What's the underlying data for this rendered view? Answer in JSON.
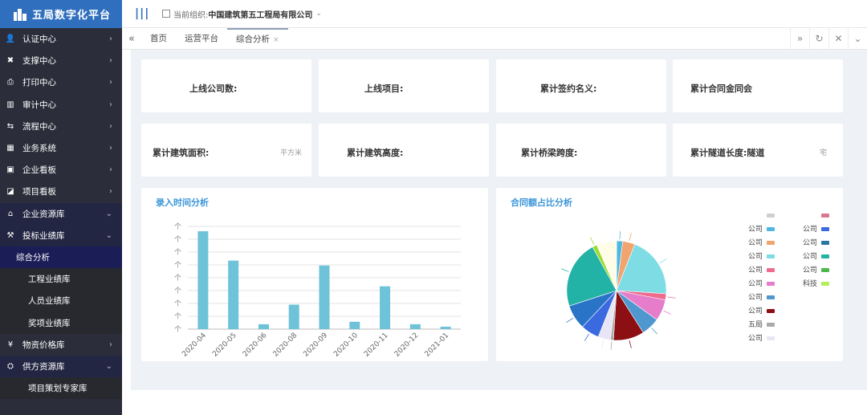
{
  "brand": {
    "title": "五局数字化平台"
  },
  "topbar": {
    "org_label": "当前组织:",
    "org_name": "中国建筑第五工程局有限公司"
  },
  "menu": [
    {
      "label": "认证中心",
      "icon": "user-icon",
      "arrow": "›"
    },
    {
      "label": "支撑中心",
      "icon": "tools-icon",
      "arrow": "›"
    },
    {
      "label": "打印中心",
      "icon": "printer-icon",
      "arrow": "›"
    },
    {
      "label": "审计中心",
      "icon": "bar-chart-icon",
      "arrow": "›"
    },
    {
      "label": "流程中心",
      "icon": "flow-icon",
      "arrow": "›"
    },
    {
      "label": "业务系统",
      "icon": "grid-icon",
      "arrow": "›"
    },
    {
      "label": "企业看板",
      "icon": "board-icon",
      "arrow": "›"
    },
    {
      "label": "项目看板",
      "icon": "project-icon",
      "arrow": "›"
    },
    {
      "label": "企业资源库",
      "icon": "bank-icon",
      "arrow": "⌄"
    },
    {
      "label": "投标业绩库",
      "icon": "gavel-icon",
      "arrow": "⌄"
    },
    {
      "label": "综合分析"
    },
    {
      "label": "工程业绩库"
    },
    {
      "label": "人员业绩库"
    },
    {
      "label": "奖项业绩库"
    },
    {
      "label": "物资价格库",
      "icon": "price-icon",
      "arrow": "›"
    },
    {
      "label": "供方资源库",
      "icon": "supplier-icon",
      "arrow": "⌄"
    },
    {
      "label": "项目策划专家库"
    }
  ],
  "tabs": [
    {
      "label": "首页"
    },
    {
      "label": "运营平台"
    },
    {
      "label": "综合分析",
      "close": "×"
    }
  ],
  "stats_row1": [
    {
      "label": "上线公司数:"
    },
    {
      "label": "上线项目:"
    },
    {
      "label": "累计签约名义:"
    },
    {
      "label": "累计合同金同会"
    }
  ],
  "stats_row2": [
    {
      "label": "累计建筑面积:",
      "unit": "平方米"
    },
    {
      "label": "累计建筑高度:"
    },
    {
      "label": "累计桥梁跨度:"
    },
    {
      "label": "累计隧道长度:隧道",
      "unit": "宅"
    }
  ],
  "bar_panel": {
    "title": "录入时间分析"
  },
  "pie_panel": {
    "title": "合同额占比分析"
  },
  "colors": {
    "accent": "#3a95d9",
    "bar": "#6ec3d8",
    "brand": "#2f6fbd"
  },
  "chart_data": [
    {
      "type": "bar",
      "title": "录入时间分析",
      "categories": [
        "2020-04",
        "2020-05",
        "2020-06",
        "2020-08",
        "2020-09",
        "2020-10",
        "2020-11",
        "2020-12",
        "2021-01"
      ],
      "values": [
        8,
        5.6,
        0.4,
        2.0,
        5.2,
        0.6,
        3.5,
        0.4,
        0.2
      ],
      "y_tick_label": "个",
      "ylim": [
        0,
        8.4
      ],
      "grid": true
    },
    {
      "type": "pie",
      "title": "合同额占比分析",
      "values": [
        2,
        4,
        20,
        2,
        7,
        6,
        10,
        1,
        4,
        6,
        8,
        22,
        1.5,
        6.5
      ],
      "colors": [
        "#4fb7e0",
        "#f2a46f",
        "#7ddce4",
        "#ef6a8d",
        "#e57dcb",
        "#4f97cf",
        "#8b0f13",
        "#a9a9a9",
        "#e8e6f5",
        "#3b6ae0",
        "#2a74c8",
        "#22b2a6",
        "#9cdb2f",
        "#fffde8"
      ],
      "legend": [
        {
          "name": "",
          "color": "#cfcfcf"
        },
        {
          "name": "",
          "color": "#d9788e"
        },
        {
          "name": "公司",
          "color": "#4fb7e0"
        },
        {
          "name": "公司",
          "color": "#3b6ae0"
        },
        {
          "name": "公司",
          "color": "#f2a46f"
        },
        {
          "name": "公司",
          "color": "#2a74a0"
        },
        {
          "name": "公司",
          "color": "#7ddce4"
        },
        {
          "name": "公司",
          "color": "#22b2a6"
        },
        {
          "name": "公司",
          "color": "#ef6a8d"
        },
        {
          "name": "公司",
          "color": "#4cb84c"
        },
        {
          "name": "公司",
          "color": "#e57dcb"
        },
        {
          "name": "科技",
          "color": "#b6ee5a"
        },
        {
          "name": "公司",
          "color": "#4f97cf"
        },
        {
          "name": "公司",
          "color": "#8b0f13"
        },
        {
          "name": "五局",
          "color": "#a9a9a9"
        },
        {
          "name": "公司",
          "color": "#e8e6f5"
        }
      ],
      "legend_position": "right"
    }
  ]
}
